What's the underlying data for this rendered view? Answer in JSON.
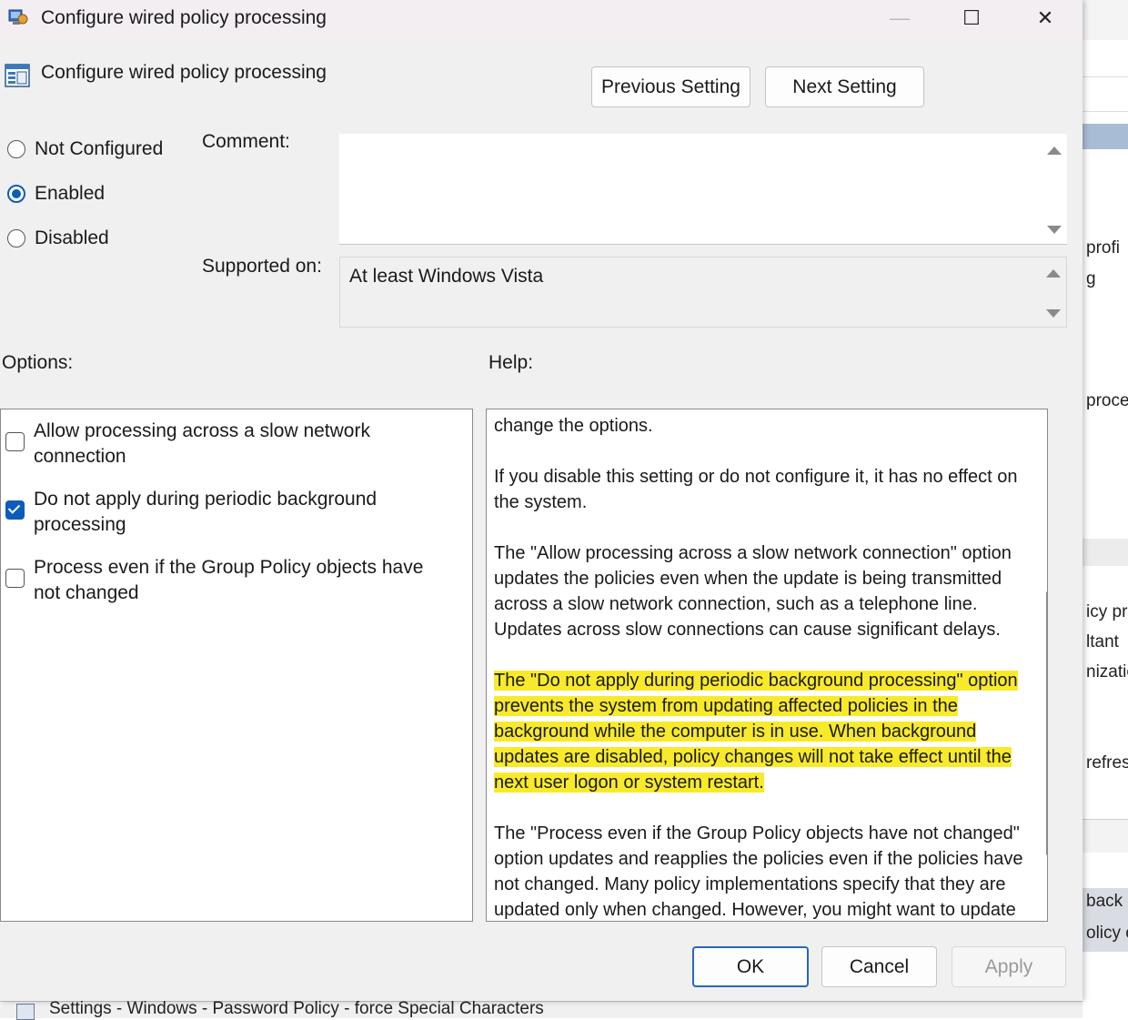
{
  "window": {
    "title": "Configure wired policy processing",
    "minimize_glyph": "—",
    "maximize_glyph": "☐",
    "close_glyph": "✕"
  },
  "header": {
    "title": "Configure wired policy processing",
    "prev_label": "Previous Setting",
    "next_label": "Next Setting"
  },
  "state": {
    "options": [
      {
        "label": "Not Configured",
        "selected": false
      },
      {
        "label": "Enabled",
        "selected": true
      },
      {
        "label": "Disabled",
        "selected": false
      }
    ]
  },
  "comment": {
    "label": "Comment:",
    "value": ""
  },
  "supported": {
    "label": "Supported on:",
    "value": "At least Windows Vista"
  },
  "options_panel": {
    "label": "Options:",
    "items": [
      {
        "label": "Allow processing across a slow network connection",
        "checked": false
      },
      {
        "label": "Do not apply during periodic background processing",
        "checked": true
      },
      {
        "label": "Process even if the Group Policy objects have not changed",
        "checked": false
      }
    ]
  },
  "help_panel": {
    "label": "Help:",
    "paragraphs": [
      "change the options.",
      "If you disable this setting or do not configure it, it has no effect on the system.",
      "The \"Allow processing across a slow network connection\" option updates the policies even when the update is being transmitted across a slow network connection, such as a telephone line. Updates across slow connections can cause significant delays.",
      "The \"Do not apply during periodic background processing\" option prevents the system from updating affected policies in the background while the computer is in use. When background updates are disabled, policy changes will not take effect until the next user logon or system restart.",
      "The \"Process even if the Group Policy objects have not changed\" option updates and reapplies the policies even if the policies have not changed. Many policy implementations specify that they are updated only when changed. However, you might want to update"
    ],
    "highlight_color": "#f8ea2a"
  },
  "footer": {
    "ok_label": "OK",
    "cancel_label": "Cancel",
    "apply_label": "Apply"
  },
  "background_window": {
    "fragments": [
      "profi",
      "g",
      "proce",
      "icy pr",
      "ltant",
      "nizatio",
      "refres",
      "back",
      "olicy c"
    ],
    "taskbar_text": "Settings - Windows - Password Policy - force Special Characters"
  },
  "colors": {
    "accent": "#0b5cbc",
    "dialog_bg": "#f0f0f0",
    "titlebar_bg": "#f3eef1"
  }
}
